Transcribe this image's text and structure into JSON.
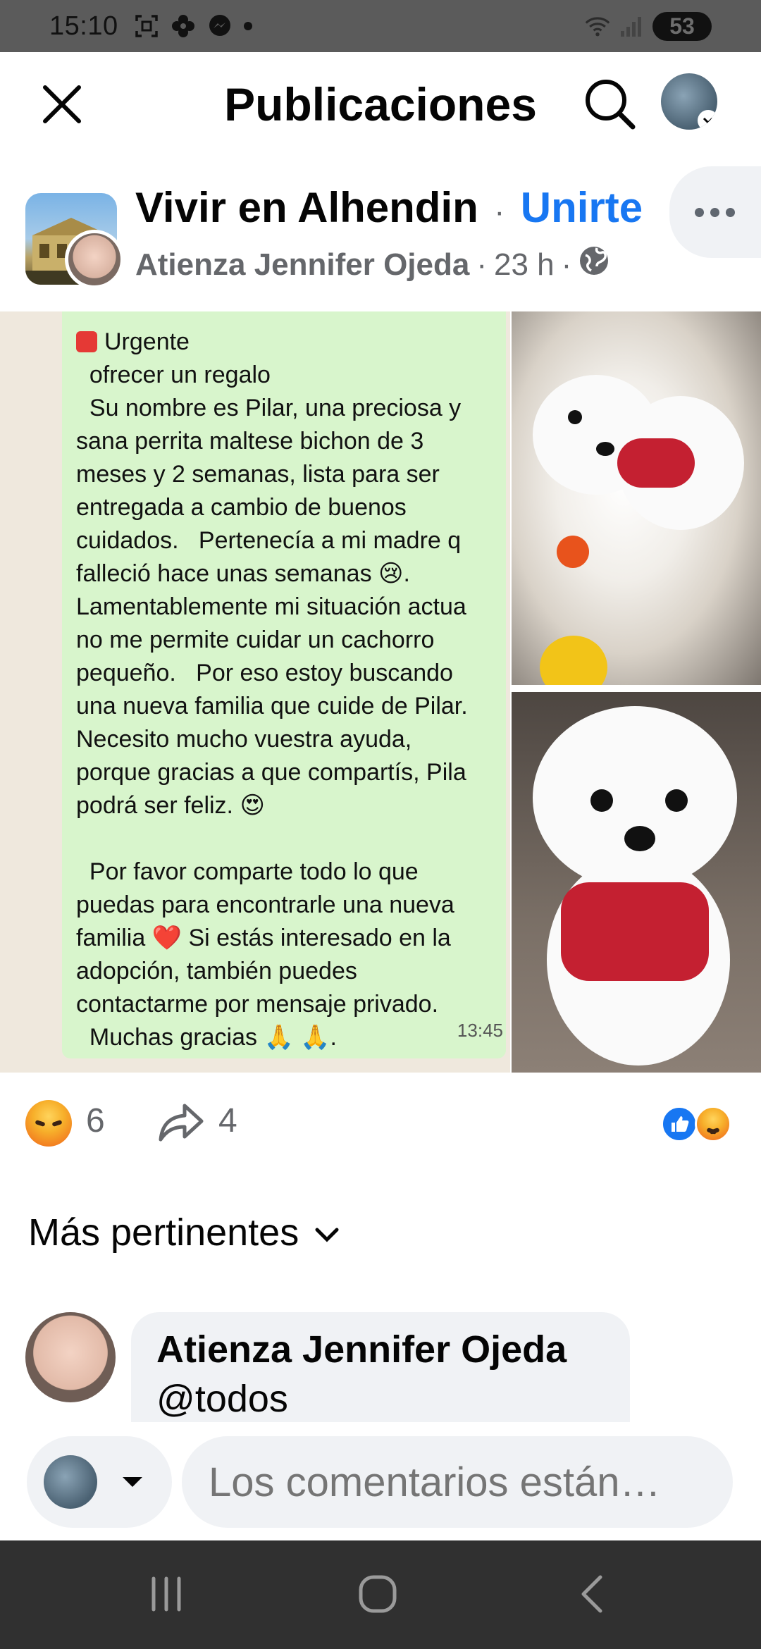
{
  "status_bar": {
    "time": "15:10",
    "battery": "53",
    "icons": [
      "screenshot-icon",
      "pinwheel-icon",
      "messenger-icon",
      "dot-icon",
      "wifi-icon",
      "signal-icon",
      "battery-icon"
    ]
  },
  "header": {
    "title": "Publicaciones",
    "close_icon": "close-icon",
    "search_icon": "search-icon"
  },
  "post": {
    "group_name": "Vivir en Alhendin",
    "separator": "·",
    "join_label": "Unirte",
    "author": "Atienza Jennifer Ojeda",
    "time_ago": "23 h",
    "visibility_icon": "globe-icon",
    "image_text": {
      "lines": [
        "Urgente",
        "  ofrecer un regalo",
        "  Su nombre es Pilar, una preciosa y",
        "sana perrita maltese bichon de 3",
        "meses y 2 semanas, lista para ser",
        "entregada a cambio de buenos",
        "cuidados.   Pertenecía a mi madre q",
        "falleció hace unas semanas 😢.",
        "Lamentablemente mi situación actua",
        "no me permite cuidar un cachorro",
        "pequeño.   Por eso estoy buscando",
        "una nueva familia que cuide de Pilar.",
        "Necesito mucho vuestra ayuda,",
        "porque gracias a que compartís, Pila",
        "podrá ser feliz. 😍",
        "",
        "  Por favor comparte todo lo que",
        "puedas para encontrarle una nueva",
        "familia ❤️ Si estás interesado en la",
        "adopción, también puedes",
        "contactarme por mensaje privado.",
        "  Muchas gracias 🙏 🙏."
      ],
      "timestamp": "13:45"
    }
  },
  "reactions": {
    "count": "6",
    "shares": "4"
  },
  "sort": {
    "label": "Más pertinentes"
  },
  "comment": {
    "author": "Atienza Jennifer Ojeda",
    "text": "@todos"
  },
  "composer": {
    "placeholder": "Los comentarios están…"
  },
  "nav": {
    "icons": [
      "recent-apps-icon",
      "home-icon",
      "back-icon"
    ]
  }
}
